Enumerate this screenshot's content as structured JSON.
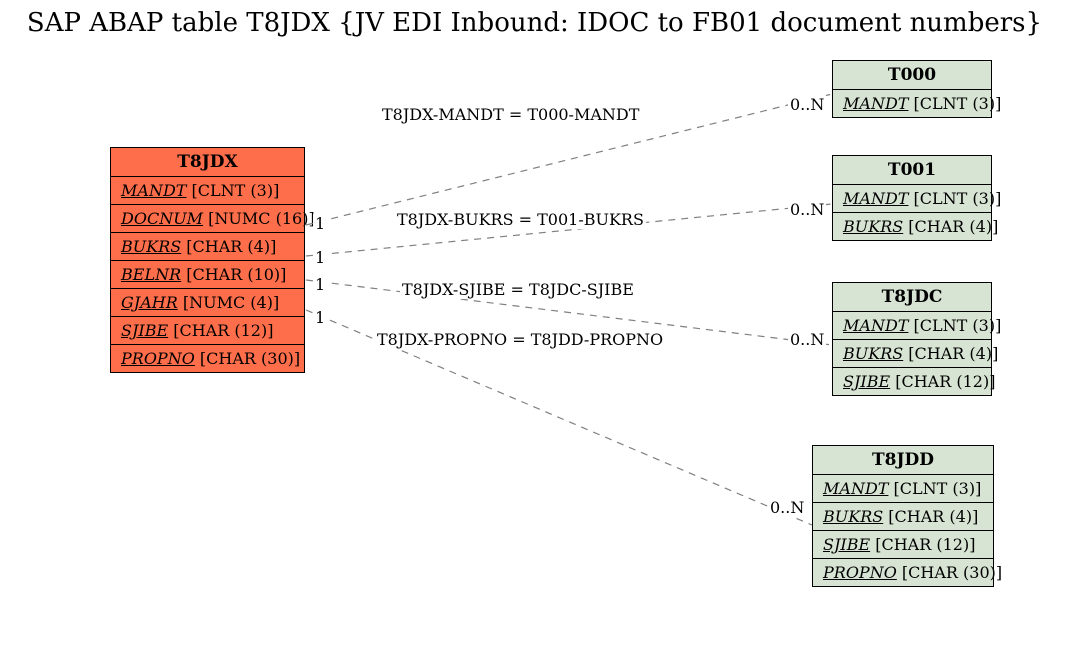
{
  "title": "SAP ABAP table T8JDX {JV EDI Inbound: IDOC to FB01 document numbers}",
  "main_table": {
    "name": "T8JDX",
    "fields": [
      {
        "field": "MANDT",
        "type": "[CLNT (3)]"
      },
      {
        "field": "DOCNUM",
        "type": "[NUMC (16)]"
      },
      {
        "field": "BUKRS",
        "type": "[CHAR (4)]"
      },
      {
        "field": "BELNR",
        "type": "[CHAR (10)]"
      },
      {
        "field": "GJAHR",
        "type": "[NUMC (4)]"
      },
      {
        "field": "SJIBE",
        "type": "[CHAR (12)]"
      },
      {
        "field": "PROPNO",
        "type": "[CHAR (30)]"
      }
    ]
  },
  "ref_tables": [
    {
      "name": "T000",
      "fields": [
        {
          "field": "MANDT",
          "type": "[CLNT (3)]"
        }
      ]
    },
    {
      "name": "T001",
      "fields": [
        {
          "field": "MANDT",
          "type": "[CLNT (3)]"
        },
        {
          "field": "BUKRS",
          "type": "[CHAR (4)]"
        }
      ]
    },
    {
      "name": "T8JDC",
      "fields": [
        {
          "field": "MANDT",
          "type": "[CLNT (3)]"
        },
        {
          "field": "BUKRS",
          "type": "[CHAR (4)]"
        },
        {
          "field": "SJIBE",
          "type": "[CHAR (12)]"
        }
      ]
    },
    {
      "name": "T8JDD",
      "fields": [
        {
          "field": "MANDT",
          "type": "[CLNT (3)]"
        },
        {
          "field": "BUKRS",
          "type": "[CHAR (4)]"
        },
        {
          "field": "SJIBE",
          "type": "[CHAR (12)]"
        },
        {
          "field": "PROPNO",
          "type": "[CHAR (30)]"
        }
      ]
    }
  ],
  "edges": [
    {
      "label": "T8JDX-MANDT = T000-MANDT",
      "src_card": "1",
      "dst_card": "0..N"
    },
    {
      "label": "T8JDX-BUKRS = T001-BUKRS",
      "src_card": "1",
      "dst_card": "0..N"
    },
    {
      "label": "T8JDX-SJIBE = T8JDC-SJIBE",
      "src_card": "1",
      "dst_card": "0..N"
    },
    {
      "label": "T8JDX-PROPNO = T8JDD-PROPNO",
      "src_card": "1",
      "dst_card": "0..N"
    }
  ]
}
